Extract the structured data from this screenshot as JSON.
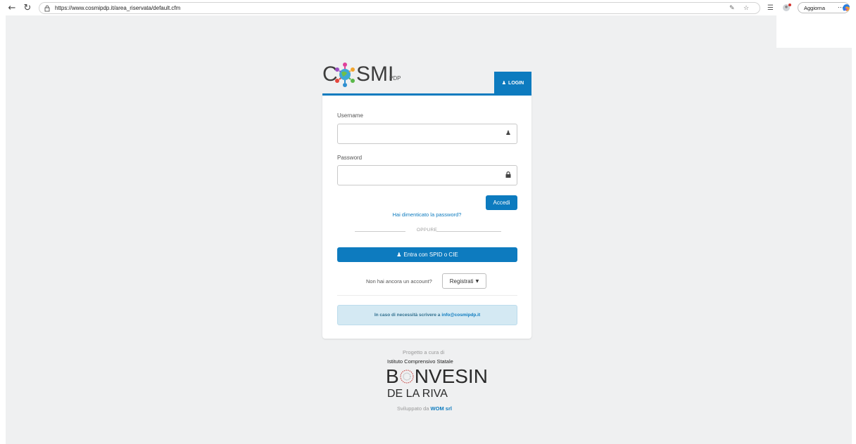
{
  "browser": {
    "url": "https://www.cosmipdp.it/area_riservata/default.cfm",
    "update_label": "Aggiorna",
    "more_label": "···"
  },
  "header": {
    "logo_c": "C",
    "logo_smi": "SMI",
    "logo_pdp": "PDP",
    "login_tab_label": "LOGIN"
  },
  "form": {
    "username_label": "Username",
    "username_value": "",
    "password_label": "Password",
    "password_value": "",
    "submit_label": "Accedi",
    "forgot_link": "Hai dimenticato la password?",
    "divider_text": "OPPURE",
    "spid_label": "Entra con SPID o CIE",
    "no_account_text": "Non hai ancora un account?",
    "register_label": "Registrati",
    "info_text": "In caso di necessità scrivere a",
    "info_email": "info@cosmipdp.it"
  },
  "footer": {
    "project_by": "Progetto a cura di",
    "institute": "Istituto Comprensivo Statale",
    "school_name_b": "B",
    "school_name_rest": "NVESIN",
    "school_subtitle": "DE LA RIVA",
    "developed_by": "Sviluppato da",
    "developer": "WOM srl"
  },
  "colors": {
    "primary": "#0d7bbf",
    "page_bg": "#eff0f1",
    "info_bg": "#d4e9f3"
  }
}
